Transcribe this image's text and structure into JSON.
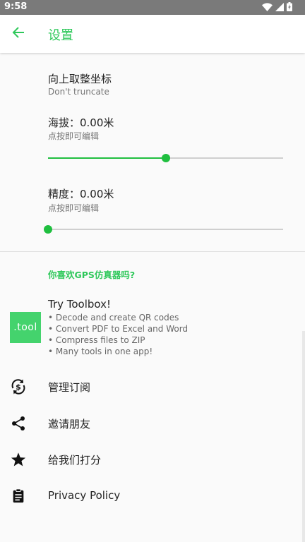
{
  "status_bar": {
    "time": "9:58",
    "icons": [
      "wifi-icon",
      "cellular-signal-icon",
      "battery-charging-icon"
    ]
  },
  "app_bar": {
    "title": "设置",
    "back_icon": "arrow-back-icon"
  },
  "preferences": {
    "round_up": {
      "title": "向上取整坐标",
      "summary": "Don't truncate"
    },
    "altitude": {
      "title": "海拔：0.00米",
      "summary": "点按即可编辑",
      "slider_fraction": 0.5
    },
    "accuracy": {
      "title": "精度：0.00米",
      "summary": "点按即可编辑",
      "slider_fraction": 0.0
    }
  },
  "section": {
    "header": "你喜欢GPS仿真器吗?"
  },
  "toolbox": {
    "logo_text": ".tool",
    "title": "Try Toolbox!",
    "lines": [
      "• Decode and create QR codes",
      "• Convert PDF to Excel and Word",
      "• Compress files to ZIP",
      "• Many tools in one app!"
    ]
  },
  "menu": [
    {
      "label": "管理订阅",
      "icon": "currency-sync-icon"
    },
    {
      "label": "邀请朋友",
      "icon": "share-icon"
    },
    {
      "label": "给我们打分",
      "icon": "star-icon"
    },
    {
      "label": "Privacy Policy",
      "icon": "clipboard-icon"
    }
  ],
  "colors": {
    "accent": "#2ec85a",
    "slider": "#1fbf3f",
    "logo_bg": "#44d36d",
    "status_bar": "#7a7a7a"
  }
}
